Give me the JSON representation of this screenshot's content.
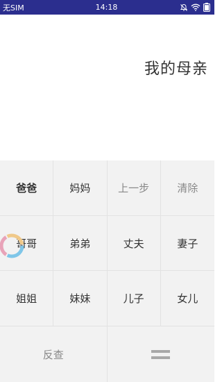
{
  "statusbar": {
    "carrier": "无SIM",
    "time": "14:18",
    "icons": [
      "alarm-off-icon",
      "wifi-icon",
      "battery-icon"
    ]
  },
  "display": {
    "result": "我的母亲"
  },
  "keypad": {
    "row1": [
      "爸爸",
      "妈妈",
      "上一步",
      "清除"
    ],
    "row2": [
      "哥哥",
      "弟弟",
      "丈夫",
      "妻子"
    ],
    "row3": [
      "姐姐",
      "妹妹",
      "儿子",
      "女儿"
    ],
    "row4": {
      "reverse": "反查",
      "equals_icon": "equals-icon"
    }
  },
  "colors": {
    "statusbar": "#2b2e8e",
    "keypad_bg": "#f2f2f2",
    "divider": "#e2e2e2",
    "text": "#333333",
    "muted_text": "#888888"
  }
}
